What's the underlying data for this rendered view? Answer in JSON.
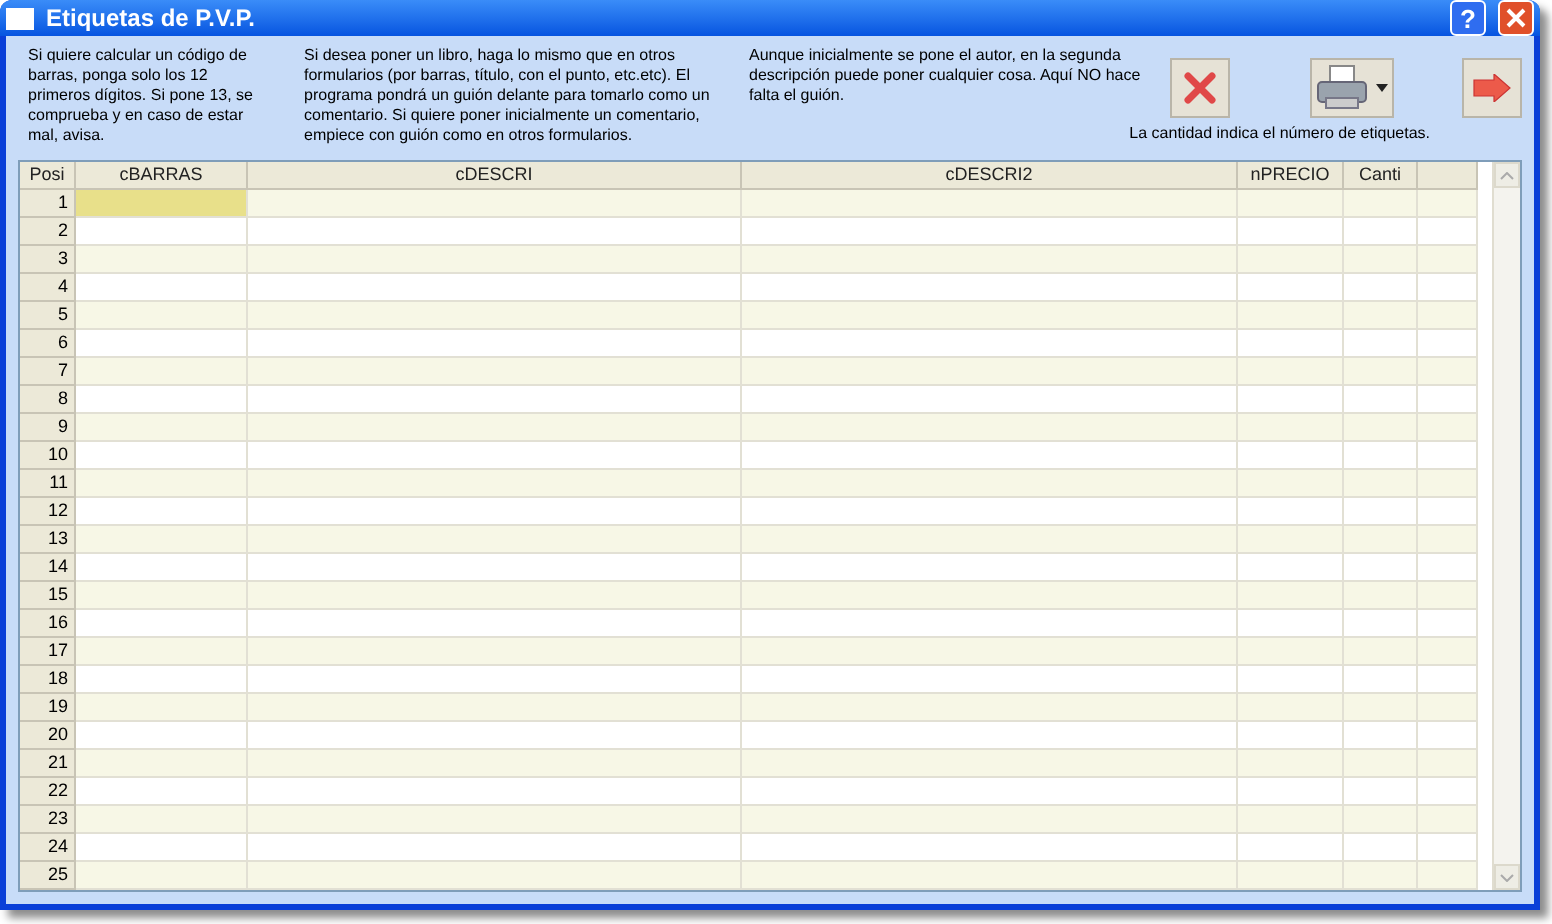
{
  "window": {
    "title": "Etiquetas de P.V.P.",
    "help_button": "?"
  },
  "notes": [
    "Si quiere calcular un código de barras, ponga solo los 12 primeros dígitos. Si pone 13, se comprueba y en caso de estar mal, avisa.",
    "Si desea poner un libro, haga lo mismo que en otros formularios (por barras, título, con el punto, etc.etc). El programa pondrá un guión delante para tomarlo como un comentario. Si quiere poner inicialmente un comentario, empiece con guión como en otros formularios.",
    "Aunque inicialmente se pone el autor, en la segunda descripción puede poner cualquier cosa. Aquí NO hace falta el guión."
  ],
  "quantity_note": "La cantidad indica el número de etiquetas.",
  "table": {
    "columns": [
      "Posi",
      "cBARRAS",
      "cDESCRI",
      "cDESCRI2",
      "nPRECIO",
      "Canti"
    ],
    "rows": [
      {
        "posi": "1",
        "selected": true
      },
      {
        "posi": "2",
        "selected": false
      },
      {
        "posi": "3",
        "selected": false
      },
      {
        "posi": "4",
        "selected": false
      },
      {
        "posi": "5",
        "selected": false
      },
      {
        "posi": "6",
        "selected": false
      },
      {
        "posi": "7",
        "selected": false
      },
      {
        "posi": "8",
        "selected": false
      },
      {
        "posi": "9",
        "selected": false
      },
      {
        "posi": "10",
        "selected": false
      },
      {
        "posi": "11",
        "selected": false
      },
      {
        "posi": "12",
        "selected": false
      },
      {
        "posi": "13",
        "selected": false
      },
      {
        "posi": "14",
        "selected": false
      },
      {
        "posi": "15",
        "selected": false
      },
      {
        "posi": "16",
        "selected": false
      },
      {
        "posi": "17",
        "selected": false
      },
      {
        "posi": "18",
        "selected": false
      },
      {
        "posi": "19",
        "selected": false
      },
      {
        "posi": "20",
        "selected": false
      },
      {
        "posi": "21",
        "selected": false
      },
      {
        "posi": "22",
        "selected": false
      },
      {
        "posi": "23",
        "selected": false
      },
      {
        "posi": "24",
        "selected": false
      },
      {
        "posi": "25",
        "selected": false
      }
    ]
  }
}
